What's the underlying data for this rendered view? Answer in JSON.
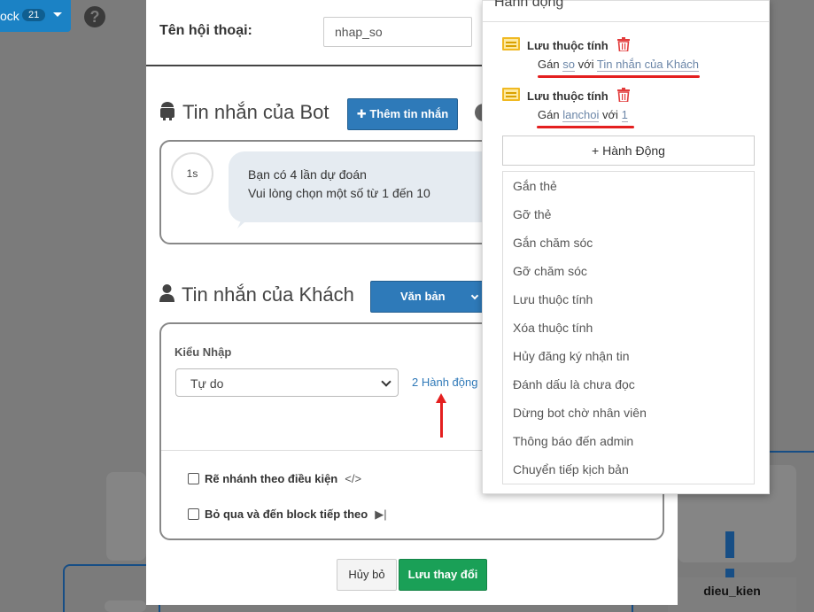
{
  "topbar": {
    "block_label": "ock",
    "block_count": "21"
  },
  "canvas": {
    "node_label": "dieu_kien"
  },
  "dialog": {
    "name_label": "Tên hội thoại:",
    "name_value": "nhap_so",
    "bot_section": {
      "title": "Tin nhắn của Bot",
      "add_button": "Thêm tin nhắn",
      "delay": "1s",
      "message_lines": [
        "Bạn có 4 lần dự đoán",
        "Vui lòng chọn một số từ 1 đến 10"
      ]
    },
    "user_section": {
      "title": "Tin nhắn của Khách",
      "type_button": "Văn bản",
      "input_type_label": "Kiểu Nhập",
      "input_type_value": "Tự do",
      "actions_link": "2 Hành động",
      "option_branch": "Rẽ nhánh theo điều kiện",
      "option_skip": "Bỏ qua và đến block tiếp theo"
    },
    "cancel_label": "Hủy bỏ",
    "save_label": "Lưu thay đổi"
  },
  "actions_panel": {
    "title": "Hành động",
    "items": [
      {
        "name": "Lưu thuộc tính",
        "prefix": "Gán",
        "attr": "so",
        "mid": "với",
        "value": "Tin nhắn của Khách"
      },
      {
        "name": "Lưu thuộc tính",
        "prefix": "Gán",
        "attr": "lanchoi",
        "mid": "với",
        "value": "1"
      }
    ],
    "add_label": "+ Hành Động",
    "menu": [
      "Gắn thẻ",
      "Gỡ thẻ",
      "Gắn chăm sóc",
      "Gỡ chăm sóc",
      "Lưu thuộc tính",
      "Xóa thuộc tính",
      "Hủy đăng ký nhận tin",
      "Đánh dấu là chưa đọc",
      "Dừng bot chờ nhân viên",
      "Thông báo đến admin",
      "Chuyển tiếp kịch bản"
    ]
  },
  "colors": {
    "primary": "#2e7ab9",
    "success": "#1aa057",
    "annotation": "#e41f1f",
    "icon_yellow": "#f0b922"
  }
}
